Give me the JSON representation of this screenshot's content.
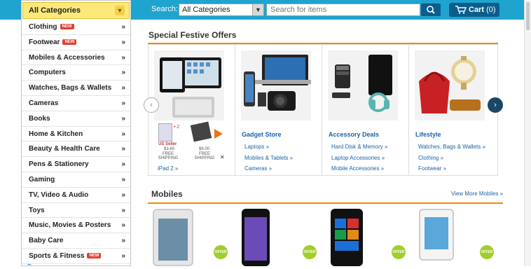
{
  "topbar": {
    "search_label": "Search:",
    "category_selected": "All Categories",
    "search_placeholder": "Search for items",
    "cart_label": "Cart",
    "cart_count": "(0)"
  },
  "sidebar": {
    "header": "All Categories",
    "items": [
      {
        "label": "Clothing",
        "badge": "NEW"
      },
      {
        "label": "Footwear",
        "badge": "NEW"
      },
      {
        "label": "Mobiles & Accessories",
        "badge": ""
      },
      {
        "label": "Computers",
        "badge": ""
      },
      {
        "label": "Watches, Bags & Wallets",
        "badge": ""
      },
      {
        "label": "Cameras",
        "badge": ""
      },
      {
        "label": "Books",
        "badge": ""
      },
      {
        "label": "Home & Kitchen",
        "badge": ""
      },
      {
        "label": "Beauty & Health Care",
        "badge": ""
      },
      {
        "label": "Pens & Stationery",
        "badge": ""
      },
      {
        "label": "Gaming",
        "badge": ""
      },
      {
        "label": "TV, Video & Audio",
        "badge": ""
      },
      {
        "label": "Toys",
        "badge": ""
      },
      {
        "label": "Music, Movies & Posters",
        "badge": ""
      },
      {
        "label": "Baby Care",
        "badge": ""
      },
      {
        "label": "Sports & Fitness",
        "badge": "NEW"
      }
    ],
    "raquo": "»"
  },
  "offers": {
    "title": "Special Festive Offers",
    "columns": [
      {
        "title": "",
        "links": [
          "iPad 2 »"
        ]
      },
      {
        "title": "Gadget Store",
        "links": [
          "Laptops »",
          "Mobiles & Tablets »",
          "Cameras »"
        ]
      },
      {
        "title": "Accessory Deals",
        "links": [
          "Hard Disk & Memory »",
          "Laptop Accessories »",
          "Mobile Accessories »"
        ]
      },
      {
        "title": "Lifestyle",
        "links": [
          "Watches, Bags & Wallets »",
          "Clothing »",
          "Footwear »"
        ]
      }
    ],
    "ad": {
      "seller": "US Seller",
      "price1": "$3.60",
      "price2": "$8.00",
      "shipping1": "FREE SHIPPING",
      "shipping2": "FREE SHIPPING",
      "close": "✕"
    }
  },
  "mobiles": {
    "title": "Mobiles",
    "view_more": "View More Mobiles »",
    "offer_label": "OFFER"
  },
  "colors": {
    "topbar": "#1fa3cf",
    "accent": "#f18b00",
    "link": "#1a62a8",
    "header_yellow": "#fde97a"
  }
}
